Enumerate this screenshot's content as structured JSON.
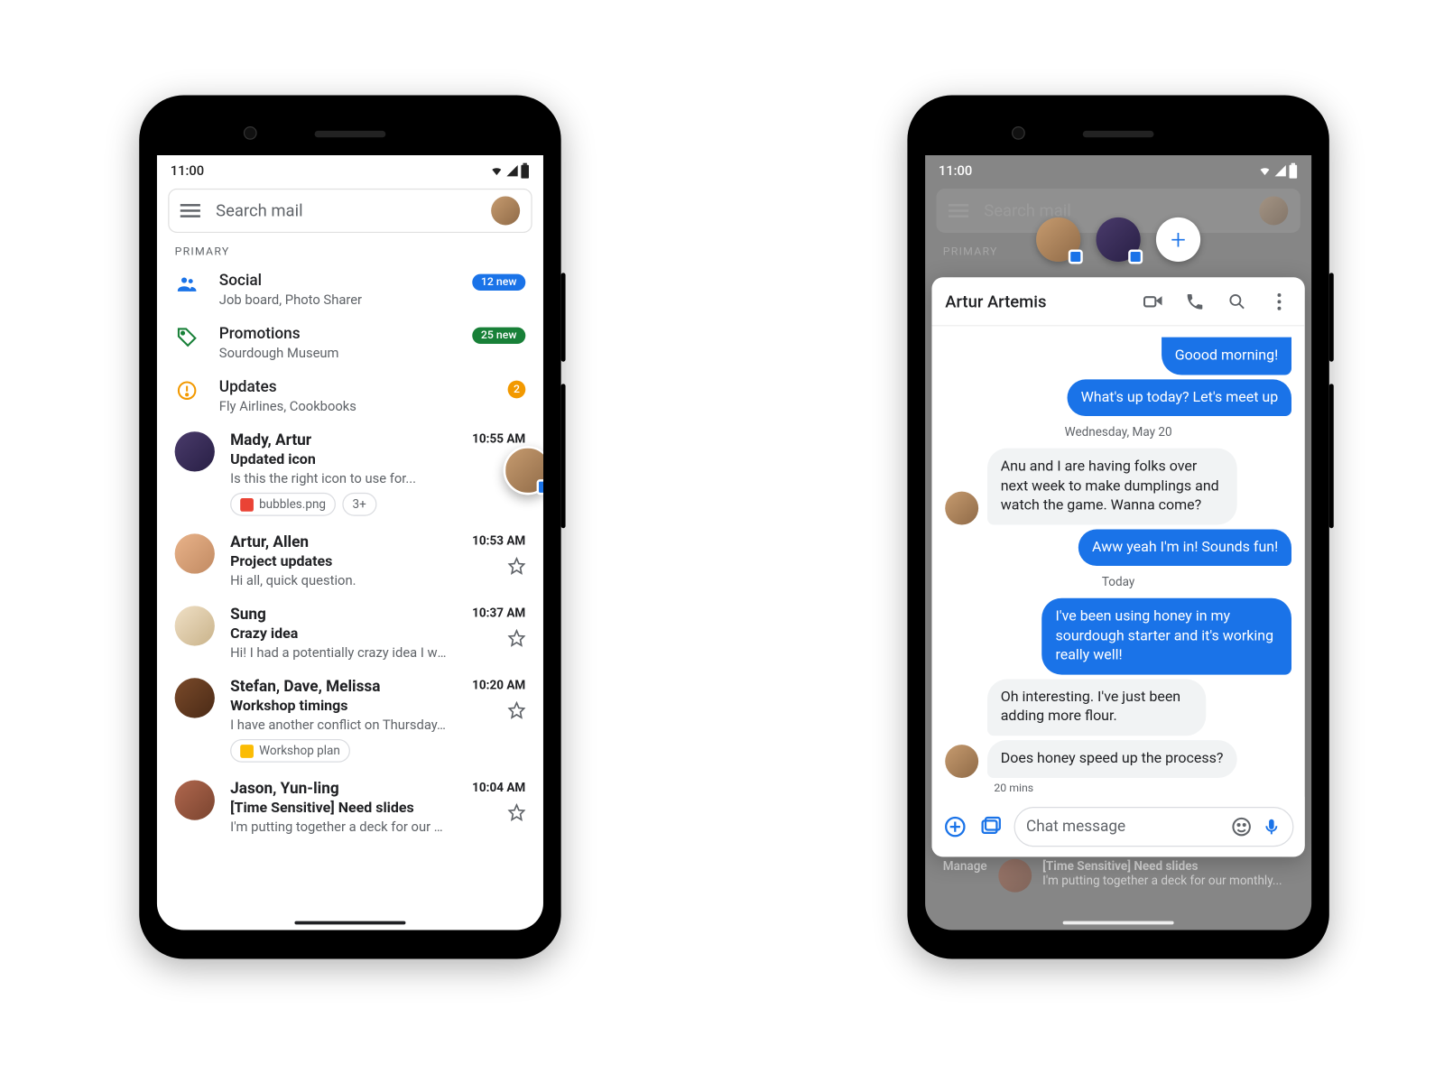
{
  "status": {
    "time": "11:00"
  },
  "gmail": {
    "search_placeholder": "Search mail",
    "section_label": "PRIMARY",
    "categories": [
      {
        "title": "Social",
        "sub": "Job board, Photo Sharer",
        "badge": "12 new",
        "badge_color": "blue"
      },
      {
        "title": "Promotions",
        "sub": "Sourdough Museum",
        "badge": "25 new",
        "badge_color": "green"
      },
      {
        "title": "Updates",
        "sub": "Fly Airlines, Cookbooks",
        "badge": "2",
        "badge_color": "orange"
      }
    ],
    "mails": [
      {
        "from": "Mady, Artur",
        "subject": "Updated icon",
        "preview": "Is this the right icon to use for...",
        "time": "10:55 AM",
        "attachments": [
          "bubbles.png",
          "3+"
        ]
      },
      {
        "from": "Artur, Allen",
        "subject": "Project updates",
        "preview": "Hi all, quick question.",
        "time": "10:53 AM"
      },
      {
        "from": "Sung",
        "subject": "Crazy idea",
        "preview": "Hi! I had a potentially crazy idea I wanted to...",
        "time": "10:37 AM"
      },
      {
        "from": "Stefan, Dave, Melissa",
        "subject": "Workshop timings",
        "preview": "I have another conflict on Thursday. Is it po...",
        "time": "10:20 AM",
        "attachments": [
          "Workshop plan"
        ]
      },
      {
        "from": "Jason, Yun-ling",
        "subject": "[Time Sensitive] Need slides",
        "preview": "I'm putting together a deck for our monthly...",
        "time": "10:04 AM"
      }
    ]
  },
  "chat": {
    "name": "Artur Artemis",
    "partial_top": "Goood morning!",
    "msg1": "What's up today? Let's meet up",
    "day1": "Wednesday, May 20",
    "recv1": "Anu and I are having folks over next week to make dumplings and watch the game. Wanna come?",
    "sent2": "Aww yeah I'm in! Sounds fun!",
    "day2": "Today",
    "sent3": "I've been using honey in my sourdough starter and it's working really well!",
    "recv2": "Oh interesting. I've just been adding more flour.",
    "recv3": "Does honey speed up the process?",
    "ts": "20 mins",
    "compose_placeholder": "Chat message"
  },
  "peek": {
    "manage": "Manage",
    "subject": "[Time Sensitive] Need slides",
    "preview": "I'm putting together a deck for our monthly..."
  }
}
